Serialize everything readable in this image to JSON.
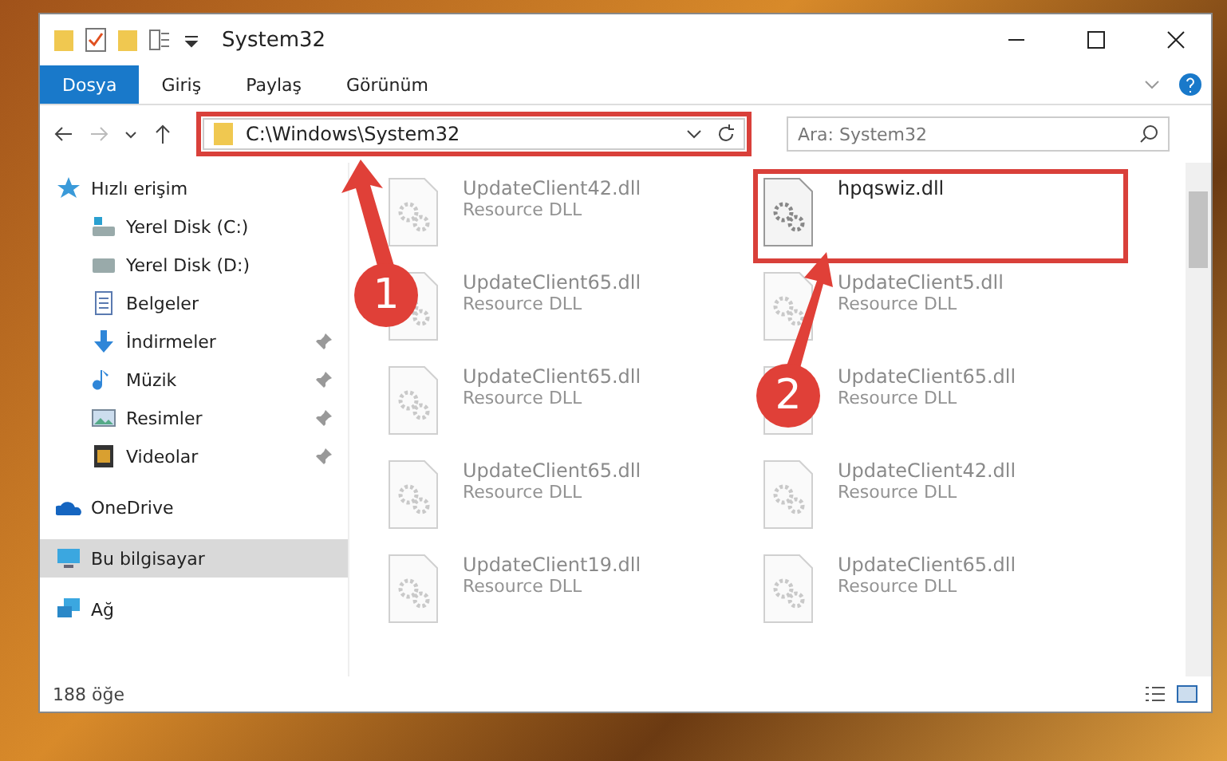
{
  "window": {
    "title": "System32"
  },
  "ribbon_tabs": [
    {
      "label": "Dosya",
      "selected": true
    },
    {
      "label": "Giriş",
      "selected": false
    },
    {
      "label": "Paylaş",
      "selected": false
    },
    {
      "label": "Görünüm",
      "selected": false
    }
  ],
  "address_bar": {
    "path": "C:\\Windows\\System32",
    "highlighted": true
  },
  "search": {
    "placeholder": "Ara: System32"
  },
  "sidebar": {
    "items": [
      {
        "label": "Hızlı erişim",
        "kind": "star",
        "selected": false,
        "children": [
          {
            "label": "Yerel Disk (C:)",
            "kind": "system-drive",
            "pinned": false,
            "selected": false
          },
          {
            "label": "Yerel Disk (D:)",
            "kind": "drive",
            "pinned": false,
            "selected": false
          },
          {
            "label": "Belgeler",
            "kind": "document",
            "pinned": false,
            "selected": false
          },
          {
            "label": "İndirmeler",
            "kind": "download",
            "pinned": true,
            "selected": false
          },
          {
            "label": "Müzik",
            "kind": "music",
            "pinned": true,
            "selected": false
          },
          {
            "label": "Resimler",
            "kind": "picture",
            "pinned": true,
            "selected": false
          },
          {
            "label": "Videolar",
            "kind": "video",
            "pinned": true,
            "selected": false
          }
        ]
      },
      {
        "label": "OneDrive",
        "kind": "cloud",
        "selected": false
      },
      {
        "label": "Bu bilgisayar",
        "kind": "computer",
        "selected": true
      },
      {
        "label": "Ağ",
        "kind": "network",
        "selected": false
      }
    ]
  },
  "files": [
    {
      "name": "UpdateClient42.dll",
      "type": "Resource DLL",
      "faded": true,
      "highlighted": false
    },
    {
      "name": "hpqswiz.dll",
      "faded": false,
      "highlighted": true
    },
    {
      "name": "UpdateClient65.dll",
      "type": "Resource DLL",
      "faded": true,
      "highlighted": false
    },
    {
      "name": "UpdateClient5.dll",
      "type": "Resource DLL",
      "faded": true,
      "highlighted": false
    },
    {
      "name": "UpdateClient65.dll",
      "type": "Resource DLL",
      "faded": true,
      "highlighted": false
    },
    {
      "name": "UpdateClient65.dll",
      "type": "Resource DLL",
      "faded": true,
      "highlighted": false
    },
    {
      "name": "UpdateClient65.dll",
      "type": "Resource DLL",
      "faded": true,
      "highlighted": false
    },
    {
      "name": "UpdateClient42.dll",
      "type": "Resource DLL",
      "faded": true,
      "highlighted": false
    },
    {
      "name": "UpdateClient19.dll",
      "type": "Resource DLL",
      "faded": true,
      "highlighted": false
    },
    {
      "name": "UpdateClient65.dll",
      "type": "Resource DLL",
      "faded": true,
      "highlighted": false
    }
  ],
  "status_bar": {
    "item_count": "188 öğe"
  },
  "annotations": [
    {
      "number": "1"
    },
    {
      "number": "2"
    }
  ]
}
